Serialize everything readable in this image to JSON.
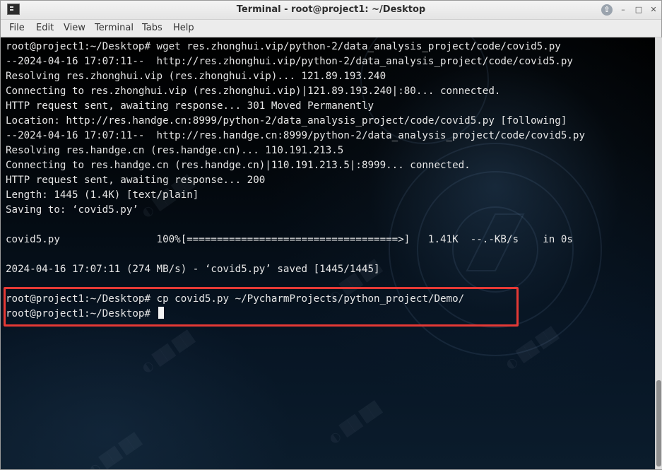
{
  "window": {
    "title": "Terminal - root@project1: ~/Desktop",
    "controls": {
      "up": "⇧",
      "minimize": "–",
      "maximize": "□",
      "close": "✕"
    }
  },
  "menu": [
    "File",
    "Edit",
    "View",
    "Terminal",
    "Tabs",
    "Help"
  ],
  "terminal": {
    "lines": [
      "root@project1:~/Desktop# wget res.zhonghui.vip/python-2/data_analysis_project/code/covid5.py",
      "--2024-04-16 17:07:11--  http://res.zhonghui.vip/python-2/data_analysis_project/code/covid5.py",
      "Resolving res.zhonghui.vip (res.zhonghui.vip)... 121.89.193.240",
      "Connecting to res.zhonghui.vip (res.zhonghui.vip)|121.89.193.240|:80... connected.",
      "HTTP request sent, awaiting response... 301 Moved Permanently",
      "Location: http://res.handge.cn:8999/python-2/data_analysis_project/code/covid5.py [following]",
      "--2024-04-16 17:07:11--  http://res.handge.cn:8999/python-2/data_analysis_project/code/covid5.py",
      "Resolving res.handge.cn (res.handge.cn)... 110.191.213.5",
      "Connecting to res.handge.cn (res.handge.cn)|110.191.213.5|:8999... connected.",
      "HTTP request sent, awaiting response... 200",
      "Length: 1445 (1.4K) [text/plain]",
      "Saving to: ‘covid5.py’",
      "",
      "covid5.py                100%[===================================>]   1.41K  --.-KB/s    in 0s",
      "",
      "2024-04-16 17:07:11 (274 MB/s) - ‘covid5.py’ saved [1445/1445]",
      "",
      "root@project1:~/Desktop# cp covid5.py ~/PycharmProjects/python_project/Demo/",
      "root@project1:~/Desktop# "
    ]
  },
  "colors": {
    "highlight": "#e53935",
    "terminal_text": "#e6e6e6"
  }
}
